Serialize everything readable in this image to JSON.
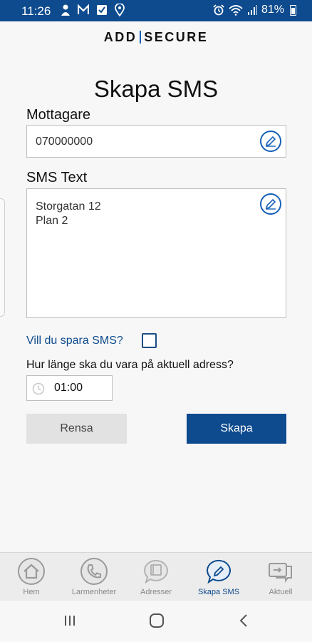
{
  "status_bar": {
    "time": "11:26",
    "battery": "81%",
    "left_icons": [
      "user-icon",
      "m-icon",
      "check-icon",
      "location-icon"
    ],
    "right_icons": [
      "alarm-icon",
      "wifi-icon",
      "signal-icon",
      "battery-icon"
    ]
  },
  "brand": {
    "left": "ADD",
    "right": "SECURE",
    "accent": "#1560b8",
    "primary": "#0d4a8e"
  },
  "page": {
    "title": "Skapa SMS"
  },
  "recipient": {
    "label": "Mottagare",
    "value": "070000000"
  },
  "sms": {
    "label": "SMS Text",
    "line1": "Storgatan 12",
    "line2": "Plan 2"
  },
  "save": {
    "question": "Vill du spara SMS?",
    "checked": false
  },
  "duration": {
    "question": "Hur länge ska du vara på aktuell adress?",
    "value": "01:00"
  },
  "buttons": {
    "clear": "Rensa",
    "create": "Skapa"
  },
  "bottom_nav": {
    "items": [
      {
        "label": "Hem",
        "icon": "home-icon",
        "active": false
      },
      {
        "label": "Larmenheter",
        "icon": "phone-icon",
        "active": false
      },
      {
        "label": "Adresser",
        "icon": "address-book-icon",
        "active": false
      },
      {
        "label": "Skapa SMS",
        "icon": "sms-edit-icon",
        "active": true
      },
      {
        "label": "Aktuell",
        "icon": "current-icon",
        "active": false
      }
    ]
  },
  "system_nav": [
    "recents-icon",
    "home-circle-icon",
    "back-icon"
  ]
}
